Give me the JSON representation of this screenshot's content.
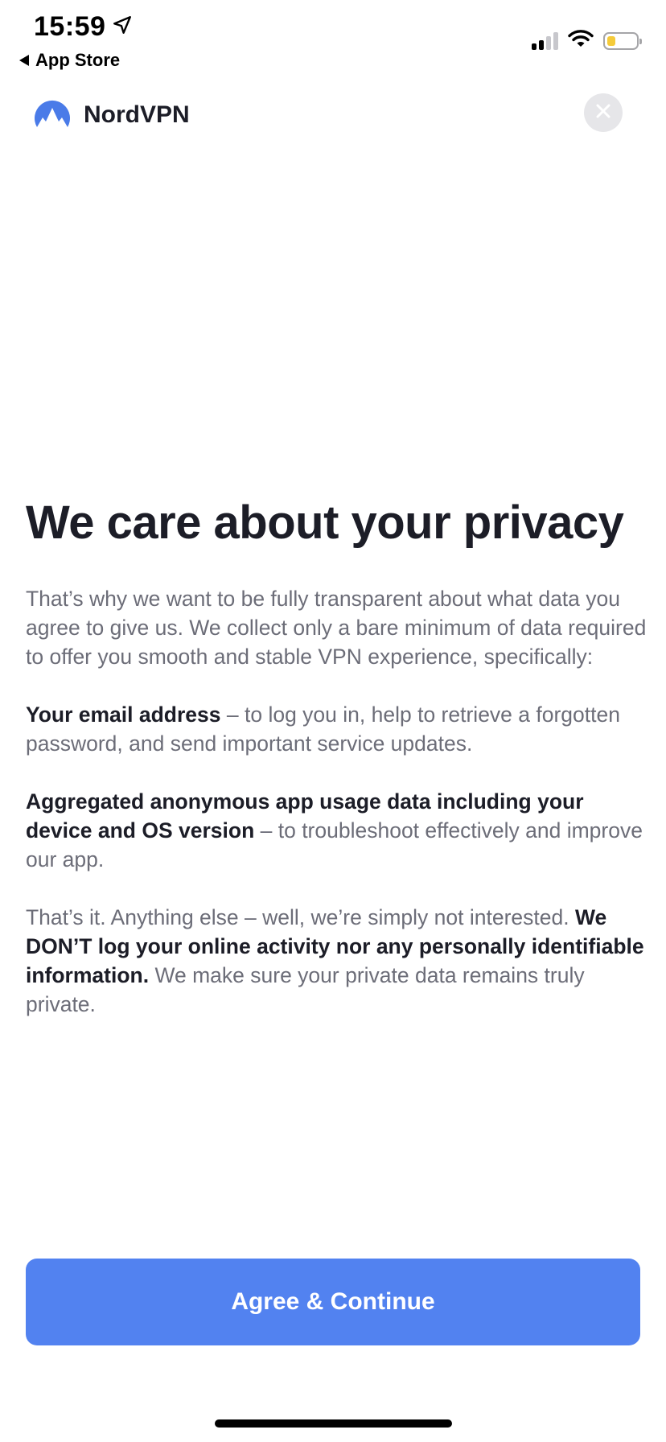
{
  "status_bar": {
    "time": "15:59",
    "location_icon": "location-arrow-icon",
    "back_label": "App Store",
    "signal_bars_on": 2,
    "signal_bars_total": 4,
    "wifi_icon": "wifi-icon",
    "battery_level": 0.3,
    "battery_color": "#f5cb3a"
  },
  "header": {
    "brand_name": "NordVPN",
    "brand_icon": "nordvpn-logo-icon",
    "brand_color": "#4a7be8",
    "close_icon": "close-icon"
  },
  "content": {
    "title": "We care about your privacy",
    "intro": "That’s why we want to be fully transparent about what data you agree to give us. We collect only a bare minimum of data required to offer you smooth and stable VPN experience, specifically:",
    "item1_bold": "Your email address",
    "item1_text": " – to log you in, help to retrieve a forgotten password, and send important service updates.",
    "item2_bold": "Aggregated anonymous app usage data including your device and OS version",
    "item2_text": " – to troubleshoot effectively and improve our app.",
    "outro_text": "That’s it. Anything else – well, we’re simply not interested. ",
    "outro_bold": "We DON’T log your online activity nor any personally identifiable information.",
    "outro_tail": " We make sure your private data remains truly private."
  },
  "cta": {
    "label": "Agree & Continue",
    "color": "#5282f0"
  }
}
